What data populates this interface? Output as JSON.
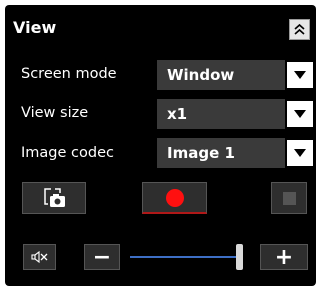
{
  "panel": {
    "title": "View",
    "collapse_icon": "double-chevron-up-icon"
  },
  "settings": [
    {
      "label": "Screen mode",
      "value": "Window"
    },
    {
      "label": "View size",
      "value": "x1"
    },
    {
      "label": "Image codec",
      "value": "Image 1"
    }
  ],
  "controls": {
    "snapshot_icon": "camera-snapshot-icon",
    "record_icon": "record-icon",
    "stop_icon": "stop-icon"
  },
  "audio": {
    "mute_icon": "speaker-muted-icon",
    "minus_label": "−",
    "plus_label": "+",
    "volume_fraction": 0.95
  },
  "colors": {
    "record_red": "#ff1010",
    "slider_blue": "#3d6ec4",
    "panel_bg": "#000000"
  }
}
